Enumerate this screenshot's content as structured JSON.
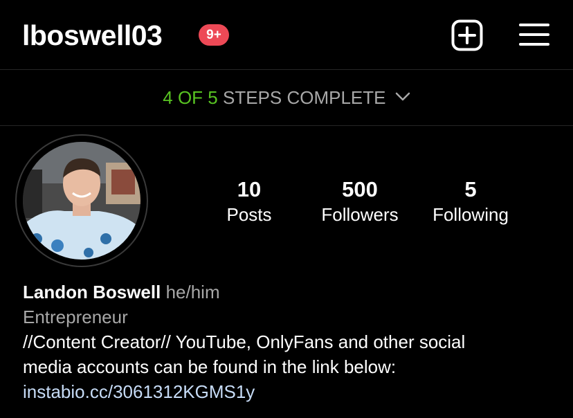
{
  "header": {
    "username": "lboswell03",
    "notification_badge": "9+"
  },
  "steps": {
    "done": "4",
    "of": "OF",
    "total": "5",
    "label": "STEPS COMPLETE"
  },
  "stats": [
    {
      "count": "10",
      "label": "Posts"
    },
    {
      "count": "500",
      "label": "Followers"
    },
    {
      "count": "5",
      "label": "Following"
    }
  ],
  "bio": {
    "name": "Landon Boswell",
    "pronouns": "he/him",
    "category": "Entrepreneur",
    "line1": "//Content Creator// YouTube, OnlyFans and other social",
    "line2": "media accounts can be found in the link below:",
    "link": "instabio.cc/3061312KGMS1y"
  },
  "icons": {
    "new_post": "plus-square-icon",
    "menu": "hamburger-menu-icon",
    "steps_toggle": "chevron-down-icon"
  },
  "colors": {
    "background": "#000000",
    "badge": "#ed4956",
    "steps_accent": "#58c322",
    "secondary_text": "#a8a8a8"
  }
}
